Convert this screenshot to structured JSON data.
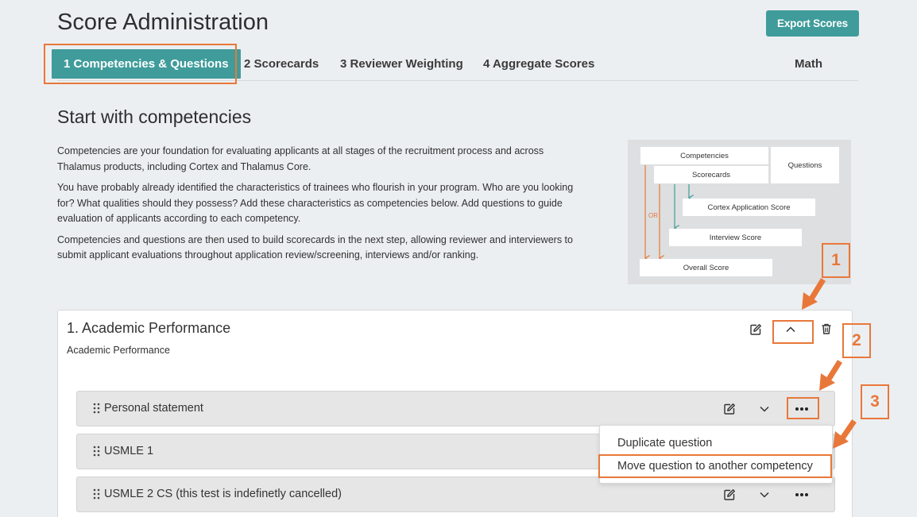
{
  "header": {
    "title": "Score Administration",
    "export_label": "Export Scores"
  },
  "tabs": [
    {
      "label": "1 Competencies & Questions",
      "active": true
    },
    {
      "label": "2 Scorecards",
      "active": false
    },
    {
      "label": "3 Reviewer Weighting",
      "active": false
    },
    {
      "label": "4 Aggregate Scores",
      "active": false
    },
    {
      "label": "Math",
      "active": false
    }
  ],
  "intro": {
    "title": "Start with competencies",
    "paragraphs": [
      "Competencies are your foundation for evaluating applicants at all stages of the recruitment process and across Thalamus products, including Cortex and Thalamus Core.",
      "You have probably already identified the characteristics of trainees who flourish in your program. Who are you looking for? What qualities should they possess? Add these characteristics as competencies below. Add questions to guide evaluation of applicants according to each competency.",
      "Competencies and questions are then used to build scorecards in the next step, allowing reviewer and interviewers to submit applicant evaluations throughout application review/screening, interviews and/or ranking."
    ]
  },
  "diagram": {
    "competencies": "Competencies",
    "scorecards": "Scorecards",
    "questions": "Questions",
    "cortex_score": "Cortex Application Score",
    "interview_score": "Interview Score",
    "overall_score": "Overall Score",
    "or_label": "OR"
  },
  "callouts": [
    "1",
    "2",
    "3"
  ],
  "competency": {
    "title": "1. Academic Performance",
    "subtitle": "Academic Performance",
    "questions": [
      {
        "label": "Personal statement"
      },
      {
        "label": "USMLE 1"
      },
      {
        "label": "USMLE 2 CS (this test is indefinetly cancelled)"
      }
    ]
  },
  "menu": {
    "duplicate": "Duplicate question",
    "move": "Move question to another competency"
  },
  "colors": {
    "accent": "#3f9c9b",
    "highlight": "#e8783a",
    "background": "#eceff2"
  }
}
